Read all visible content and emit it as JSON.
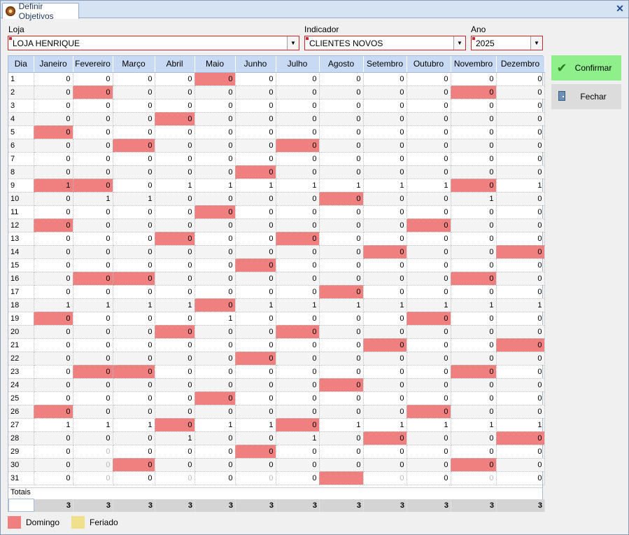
{
  "tab": {
    "title": "Definir Objetivos",
    "icon": "app-icon",
    "close_icon": "close-icon"
  },
  "filters": {
    "loja": {
      "label": "Loja",
      "value": "LOJA HENRIQUE"
    },
    "indicador": {
      "label": "Indicador",
      "value": "CLIENTES NOVOS"
    },
    "ano": {
      "label": "Ano",
      "value": "2025"
    }
  },
  "buttons": {
    "confirm": "Confirmar",
    "close": "Fechar"
  },
  "colors": {
    "domingo": "#f08080",
    "feriado": "#f0e08c",
    "header": "#c8daf3",
    "confirm": "#8ef08a"
  },
  "grid": {
    "day_header": "Dia",
    "months": [
      "Janeiro",
      "Fevereiro",
      "Março",
      "Abril",
      "Maio",
      "Junho",
      "Julho",
      "Agosto",
      "Setembro",
      "Outubro",
      "Novembro",
      "Dezembro"
    ],
    "rows": [
      {
        "day": "1",
        "values": [
          "0",
          "0",
          "0",
          "0",
          "0",
          "0",
          "0",
          "0",
          "0",
          "0",
          "0",
          "0"
        ]
      },
      {
        "day": "2",
        "values": [
          "0",
          "0",
          "0",
          "0",
          "0",
          "0",
          "0",
          "0",
          "0",
          "0",
          "0",
          "0"
        ]
      },
      {
        "day": "3",
        "values": [
          "0",
          "0",
          "0",
          "0",
          "0",
          "0",
          "0",
          "0",
          "0",
          "0",
          "0",
          "0"
        ]
      },
      {
        "day": "4",
        "values": [
          "0",
          "0",
          "0",
          "0",
          "0",
          "0",
          "0",
          "0",
          "0",
          "0",
          "0",
          "0"
        ]
      },
      {
        "day": "5",
        "values": [
          "0",
          "0",
          "0",
          "0",
          "0",
          "0",
          "0",
          "0",
          "0",
          "0",
          "0",
          "0"
        ]
      },
      {
        "day": "6",
        "values": [
          "0",
          "0",
          "0",
          "0",
          "0",
          "0",
          "0",
          "0",
          "0",
          "0",
          "0",
          "0"
        ]
      },
      {
        "day": "7",
        "values": [
          "0",
          "0",
          "0",
          "0",
          "0",
          "0",
          "0",
          "0",
          "0",
          "0",
          "0",
          "0"
        ]
      },
      {
        "day": "8",
        "values": [
          "0",
          "0",
          "0",
          "0",
          "0",
          "0",
          "0",
          "0",
          "0",
          "0",
          "0",
          "0"
        ]
      },
      {
        "day": "9",
        "values": [
          "1",
          "0",
          "0",
          "1",
          "1",
          "1",
          "1",
          "1",
          "1",
          "1",
          "0",
          "1"
        ]
      },
      {
        "day": "10",
        "values": [
          "0",
          "1",
          "1",
          "0",
          "0",
          "0",
          "0",
          "0",
          "0",
          "0",
          "1",
          "0"
        ]
      },
      {
        "day": "11",
        "values": [
          "0",
          "0",
          "0",
          "0",
          "0",
          "0",
          "0",
          "0",
          "0",
          "0",
          "0",
          "0"
        ]
      },
      {
        "day": "12",
        "values": [
          "0",
          "0",
          "0",
          "0",
          "0",
          "0",
          "0",
          "0",
          "0",
          "0",
          "0",
          "0"
        ]
      },
      {
        "day": "13",
        "values": [
          "0",
          "0",
          "0",
          "0",
          "0",
          "0",
          "0",
          "0",
          "0",
          "0",
          "0",
          "0"
        ]
      },
      {
        "day": "14",
        "values": [
          "0",
          "0",
          "0",
          "0",
          "0",
          "0",
          "0",
          "0",
          "0",
          "0",
          "0",
          "0"
        ]
      },
      {
        "day": "15",
        "values": [
          "0",
          "0",
          "0",
          "0",
          "0",
          "0",
          "0",
          "0",
          "0",
          "0",
          "0",
          "0"
        ]
      },
      {
        "day": "16",
        "values": [
          "0",
          "0",
          "0",
          "0",
          "0",
          "0",
          "0",
          "0",
          "0",
          "0",
          "0",
          "0"
        ]
      },
      {
        "day": "17",
        "values": [
          "0",
          "0",
          "0",
          "0",
          "0",
          "0",
          "0",
          "0",
          "0",
          "0",
          "0",
          "0"
        ]
      },
      {
        "day": "18",
        "values": [
          "1",
          "1",
          "1",
          "1",
          "0",
          "1",
          "1",
          "1",
          "1",
          "1",
          "1",
          "1"
        ]
      },
      {
        "day": "19",
        "values": [
          "0",
          "0",
          "0",
          "0",
          "1",
          "0",
          "0",
          "0",
          "0",
          "0",
          "0",
          "0"
        ]
      },
      {
        "day": "20",
        "values": [
          "0",
          "0",
          "0",
          "0",
          "0",
          "0",
          "0",
          "0",
          "0",
          "0",
          "0",
          "0"
        ]
      },
      {
        "day": "21",
        "values": [
          "0",
          "0",
          "0",
          "0",
          "0",
          "0",
          "0",
          "0",
          "0",
          "0",
          "0",
          "0"
        ]
      },
      {
        "day": "22",
        "values": [
          "0",
          "0",
          "0",
          "0",
          "0",
          "0",
          "0",
          "0",
          "0",
          "0",
          "0",
          "0"
        ]
      },
      {
        "day": "23",
        "values": [
          "0",
          "0",
          "0",
          "0",
          "0",
          "0",
          "0",
          "0",
          "0",
          "0",
          "0",
          "0"
        ]
      },
      {
        "day": "24",
        "values": [
          "0",
          "0",
          "0",
          "0",
          "0",
          "0",
          "0",
          "0",
          "0",
          "0",
          "0",
          "0"
        ]
      },
      {
        "day": "25",
        "values": [
          "0",
          "0",
          "0",
          "0",
          "0",
          "0",
          "0",
          "0",
          "0",
          "0",
          "0",
          "0"
        ]
      },
      {
        "day": "26",
        "values": [
          "0",
          "0",
          "0",
          "0",
          "0",
          "0",
          "0",
          "0",
          "0",
          "0",
          "0",
          "0"
        ]
      },
      {
        "day": "27",
        "values": [
          "1",
          "1",
          "1",
          "0",
          "1",
          "1",
          "0",
          "1",
          "1",
          "1",
          "1",
          "1"
        ]
      },
      {
        "day": "28",
        "values": [
          "0",
          "0",
          "0",
          "1",
          "0",
          "0",
          "1",
          "0",
          "0",
          "0",
          "0",
          "0"
        ]
      },
      {
        "day": "29",
        "values": [
          "0",
          "0",
          "0",
          "0",
          "0",
          "0",
          "0",
          "0",
          "0",
          "0",
          "0",
          "0"
        ]
      },
      {
        "day": "30",
        "values": [
          "0",
          "0",
          "0",
          "0",
          "0",
          "0",
          "0",
          "0",
          "0",
          "0",
          "0",
          "0"
        ]
      },
      {
        "day": "31",
        "values": [
          "0",
          "0",
          "0",
          "0",
          "0",
          "0",
          "0",
          "",
          "0",
          "0",
          "0",
          "0"
        ]
      }
    ],
    "sundays": [
      [
        4
      ],
      [
        1,
        10
      ],
      [],
      [
        3
      ],
      [
        0
      ],
      [
        2,
        6
      ],
      [],
      [
        5
      ],
      [
        0,
        1,
        10
      ],
      [
        7
      ],
      [
        4
      ],
      [
        0,
        9
      ],
      [
        3,
        6
      ],
      [
        8,
        11
      ],
      [
        5
      ],
      [
        1,
        2,
        10
      ],
      [
        7
      ],
      [
        4
      ],
      [
        0,
        9
      ],
      [
        3,
        6
      ],
      [
        8,
        11
      ],
      [
        5
      ],
      [
        1,
        2,
        10
      ],
      [
        7
      ],
      [
        4
      ],
      [
        0,
        9
      ],
      [
        3,
        6
      ],
      [
        8,
        11
      ],
      [
        5
      ],
      [
        2,
        10
      ],
      [
        7
      ]
    ],
    "inactive": [
      [],
      [],
      [],
      [],
      [],
      [],
      [],
      [],
      [],
      [],
      [],
      [],
      [],
      [],
      [],
      [],
      [],
      [],
      [],
      [],
      [],
      [],
      [],
      [],
      [],
      [],
      [],
      [],
      [
        1
      ],
      [
        1
      ],
      [
        1,
        3,
        5,
        8,
        10
      ]
    ],
    "totals_label": "Totais",
    "totals": [
      "3",
      "3",
      "3",
      "3",
      "3",
      "3",
      "3",
      "3",
      "3",
      "3",
      "3",
      "3"
    ]
  },
  "legend": {
    "domingo": "Domingo",
    "feriado": "Feriado"
  }
}
